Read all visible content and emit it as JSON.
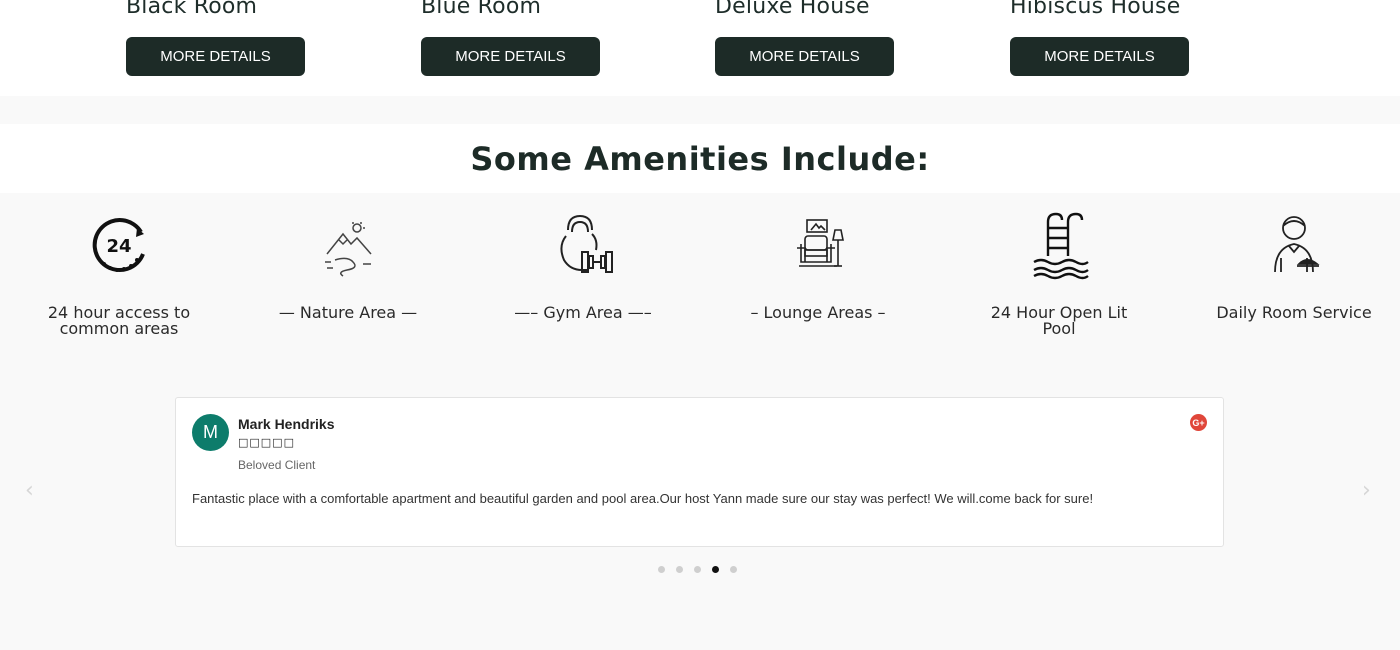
{
  "rooms": [
    {
      "name": "Black Room",
      "button": "MORE DETAILS"
    },
    {
      "name": "Blue Room",
      "button": "MORE DETAILS"
    },
    {
      "name": "Deluxe House",
      "button": "MORE DETAILS"
    },
    {
      "name": "Hibiscus House",
      "button": "MORE DETAILS"
    }
  ],
  "amenities": {
    "title": "Some Amenities Include:",
    "items": [
      {
        "icon": "24-hour-icon",
        "label": "24 hour access to common areas"
      },
      {
        "icon": "mountain-river-icon",
        "label": "— Nature Area —"
      },
      {
        "icon": "kettlebell-dumbbell-icon",
        "label": "—– Gym Area —–"
      },
      {
        "icon": "armchair-lamp-icon",
        "label": "– Lounge Areas –"
      },
      {
        "icon": "pool-ladder-icon",
        "label": "24 Hour Open Lit Pool"
      },
      {
        "icon": "room-service-waiter-icon",
        "label": "Daily Room Service"
      }
    ]
  },
  "review": {
    "avatar_letter": "M",
    "reviewer": "Mark Hendriks",
    "stars": "□□□□□",
    "role": "Beloved Client",
    "source_icon": "google-plus-icon",
    "source_label": "G+",
    "text": "Fantastic place with a comfortable apartment and beautiful garden and pool area.Our host Yann made sure our stay was perfect! We will.come back for sure!"
  },
  "carousel": {
    "prev": "‹",
    "next": "›",
    "dots": 5,
    "active_dot": 4
  },
  "colors": {
    "button_bg": "#1d2b27",
    "avatar_bg": "#0d7c6b",
    "google_plus": "#e0463a"
  }
}
